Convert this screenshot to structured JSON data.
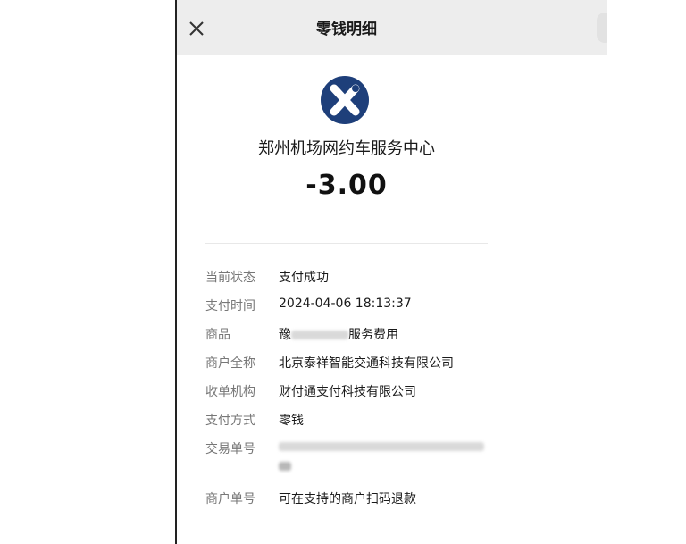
{
  "nav": {
    "title": "零钱明细"
  },
  "header": {
    "merchant": "郑州机场网约车服务中心",
    "amount": "-3.00",
    "logo_color": "#1e3f7a"
  },
  "details": {
    "status": {
      "label": "当前状态",
      "value": "支付成功"
    },
    "time": {
      "label": "支付时间",
      "value": "2024-04-06 18:13:37"
    },
    "goods": {
      "label": "商品",
      "prefix": "豫",
      "suffix": "服务费用"
    },
    "merchant_name": {
      "label": "商户全称",
      "value": "北京泰祥智能交通科技有限公司"
    },
    "acquirer": {
      "label": "收单机构",
      "value": "财付通支付科技有限公司"
    },
    "method": {
      "label": "支付方式",
      "value": "零钱"
    },
    "transaction_no": {
      "label": "交易单号"
    },
    "merchant_no": {
      "label": "商户单号",
      "value": "可在支持的商户扫码退款"
    }
  }
}
